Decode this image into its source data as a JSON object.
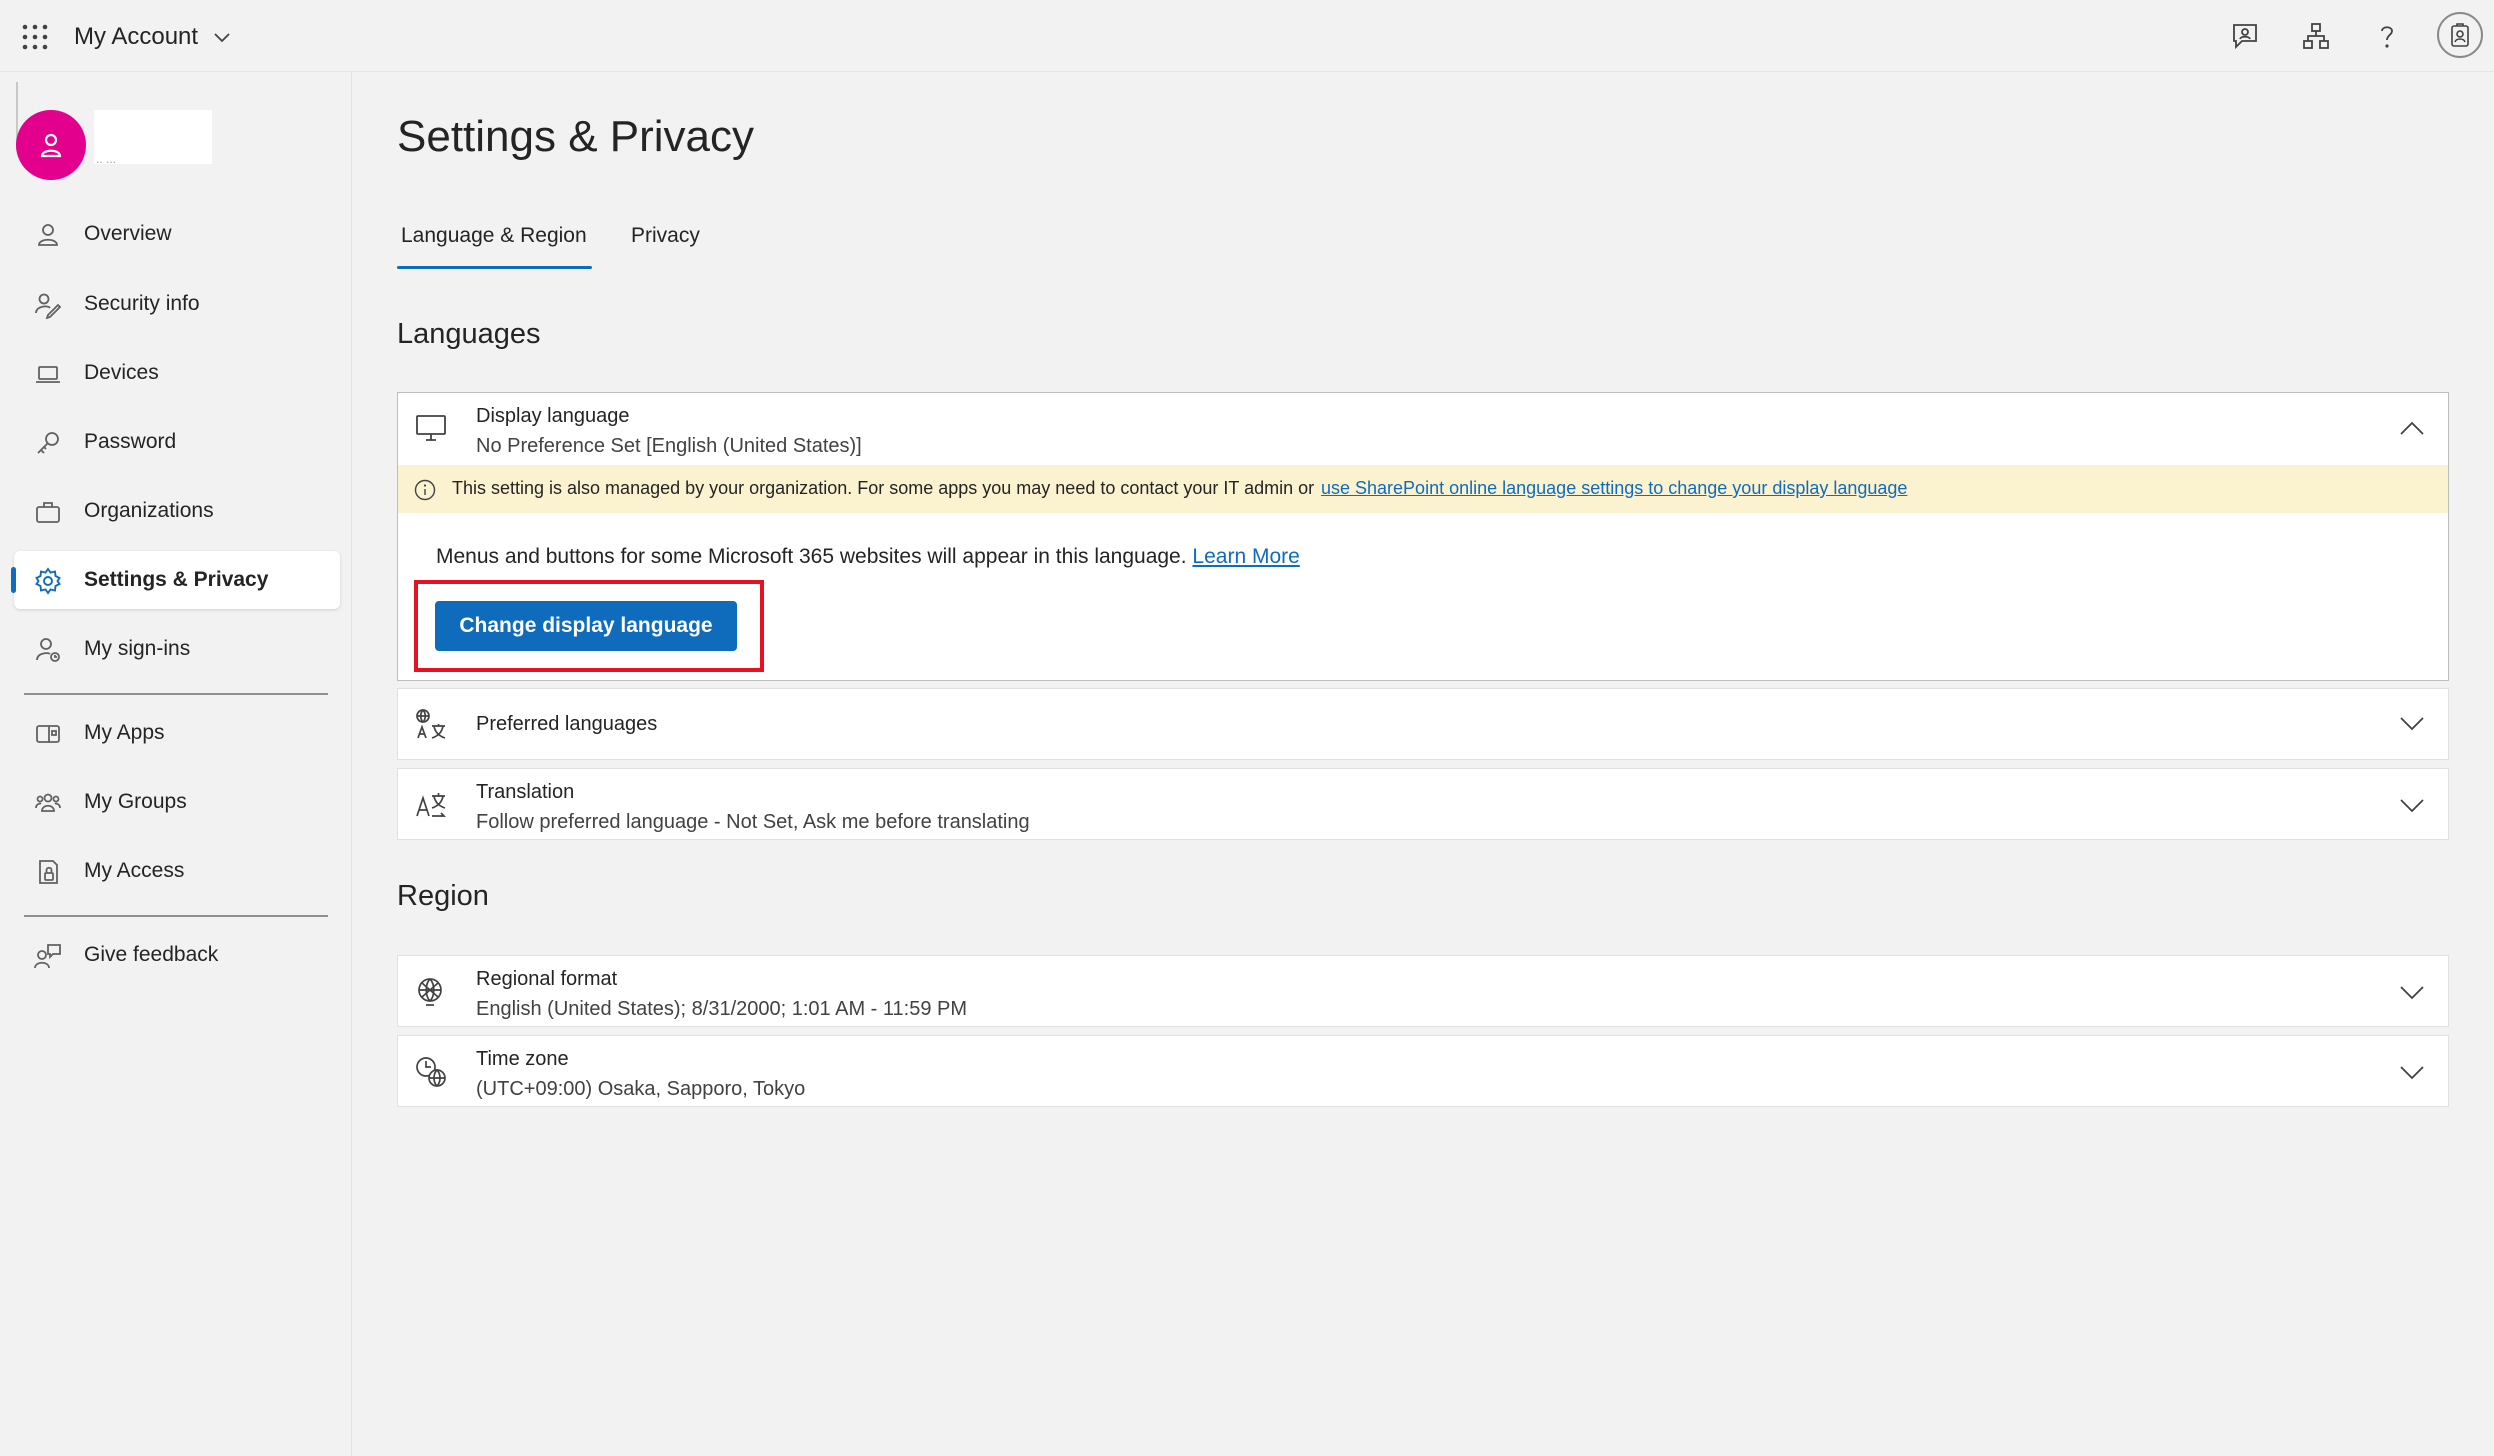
{
  "header": {
    "app_title": "My Account"
  },
  "user": {
    "sub_text": ".. ..."
  },
  "sidebar": {
    "items": [
      {
        "label": "Overview"
      },
      {
        "label": "Security info"
      },
      {
        "label": "Devices"
      },
      {
        "label": "Password"
      },
      {
        "label": "Organizations"
      },
      {
        "label": "Settings & Privacy"
      },
      {
        "label": "My sign-ins"
      },
      {
        "label": "My Apps"
      },
      {
        "label": "My Groups"
      },
      {
        "label": "My Access"
      },
      {
        "label": "Give feedback"
      }
    ],
    "active_index": 5
  },
  "main": {
    "page_title": "Settings & Privacy",
    "tabs": [
      {
        "label": "Language & Region"
      },
      {
        "label": "Privacy"
      }
    ],
    "active_tab": 0,
    "languages_heading": "Languages",
    "region_heading": "Region",
    "display_language": {
      "title": "Display language",
      "value": "No Preference Set [English (United States)]",
      "info_text": "This setting is also managed by your organization. For some apps you may need to contact your IT admin or",
      "info_link": "use SharePoint online language settings to change your display language",
      "description": "Menus and buttons for some Microsoft 365 websites will appear in this language.",
      "learn_more": "Learn More",
      "button_label": "Change display language"
    },
    "preferred_languages": {
      "title": "Preferred languages"
    },
    "translation": {
      "title": "Translation",
      "value": "Follow preferred language - Not Set, Ask me before translating"
    },
    "regional_format": {
      "title": "Regional format",
      "value": "English (United States); 8/31/2000; 1:01 AM - 11:59 PM"
    },
    "time_zone": {
      "title": "Time zone",
      "value": "(UTC+09:00) Osaka, Sapporo, Tokyo"
    }
  },
  "colors": {
    "accent": "#0f6cbd",
    "avatar": "#e3008c",
    "highlight": "#e81123",
    "info_banner": "#fbf2d0"
  }
}
